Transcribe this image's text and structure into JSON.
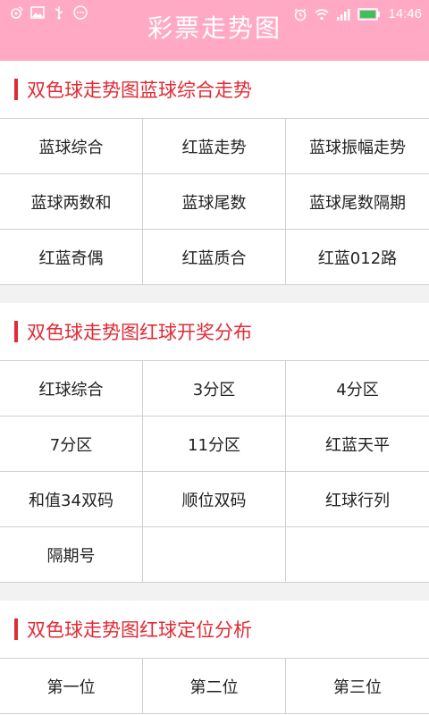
{
  "status_bar": {
    "time": "14:46",
    "icons_left": [
      "weibo-icon",
      "image-icon",
      "usb-icon",
      "more-icon"
    ],
    "icons_right": [
      "alarm-icon",
      "wifi-icon",
      "signal-icon",
      "battery-icon"
    ]
  },
  "app": {
    "title": "彩票走势图"
  },
  "sections": [
    {
      "title": "双色球走势图蓝球综合走势",
      "items": [
        "蓝球综合",
        "红蓝走势",
        "蓝球振幅走势",
        "蓝球两数和",
        "蓝球尾数",
        "蓝球尾数隔期",
        "红蓝奇偶",
        "红蓝质合",
        "红蓝012路"
      ]
    },
    {
      "title": "双色球走势图红球开奖分布",
      "items": [
        "红球综合",
        "3分区",
        "4分区",
        "7分区",
        "11分区",
        "红蓝天平",
        "和值34双码",
        "顺位双码",
        "红球行列",
        "隔期号",
        "",
        ""
      ]
    },
    {
      "title": "双色球走势图红球定位分析",
      "items": [
        "第一位",
        "第二位",
        "第三位"
      ]
    }
  ],
  "colors": {
    "accent": "#e02b35",
    "header_bg": "#ffa9c5"
  }
}
